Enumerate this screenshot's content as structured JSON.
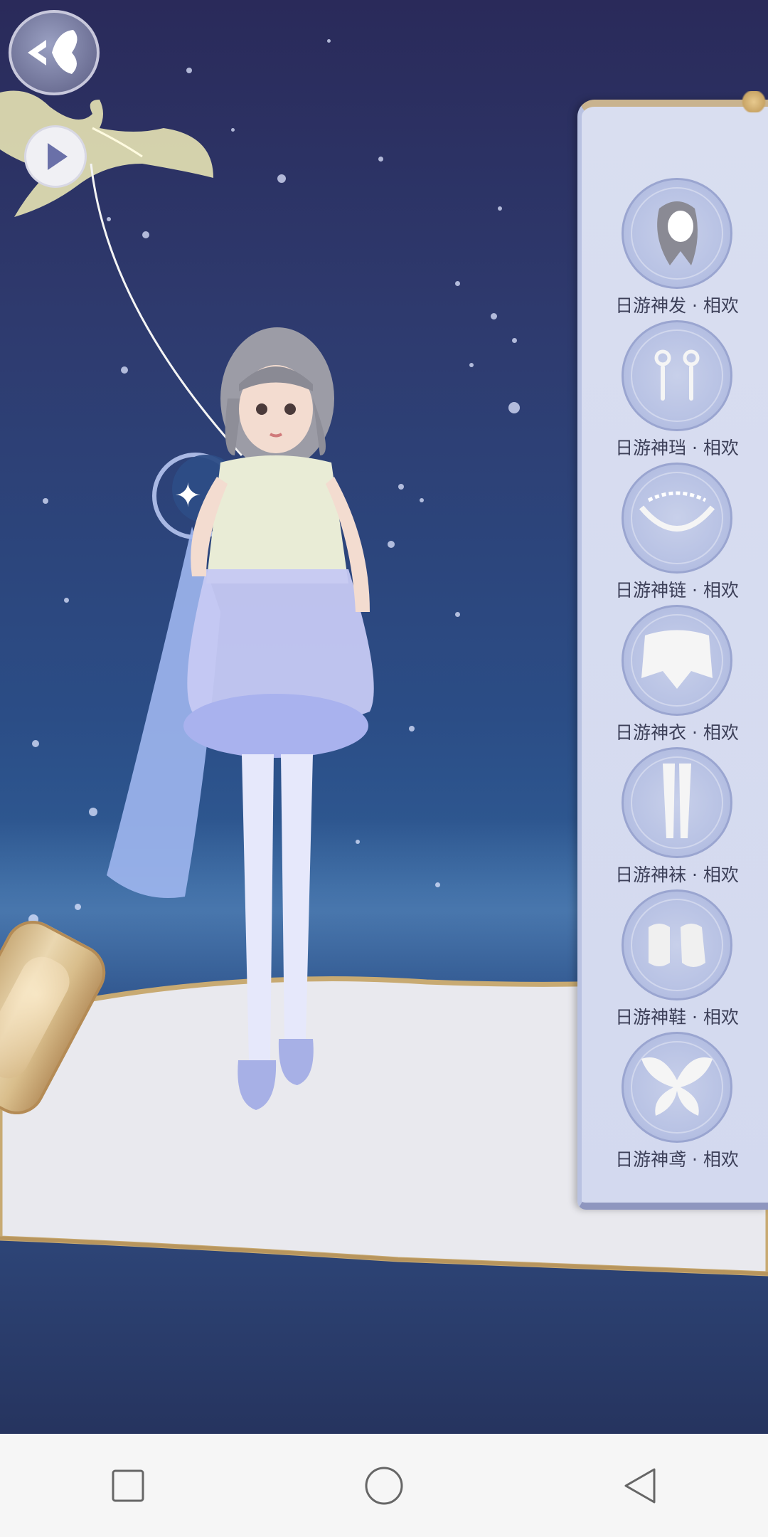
{
  "app": {
    "back_button": {
      "icon": "back-butterfly-icon"
    },
    "play_button": {
      "icon": "play-icon"
    }
  },
  "outfit_panel": {
    "items": [
      {
        "label": "日游神发 · 相欢",
        "icon": "hair-icon"
      },
      {
        "label": "日游神珰 · 相欢",
        "icon": "earrings-icon"
      },
      {
        "label": "日游神链 · 相欢",
        "icon": "necklace-icon"
      },
      {
        "label": "日游神衣 · 相欢",
        "icon": "dress-icon"
      },
      {
        "label": "日游神袜 · 相欢",
        "icon": "stockings-icon"
      },
      {
        "label": "日游神鞋 · 相欢",
        "icon": "shoes-icon"
      },
      {
        "label": "日游神鸢 · 相欢",
        "icon": "kite-icon"
      }
    ]
  },
  "navbar": {
    "buttons": [
      {
        "name": "recents",
        "icon": "square-icon"
      },
      {
        "name": "home",
        "icon": "circle-icon"
      },
      {
        "name": "back",
        "icon": "triangle-back-icon"
      }
    ]
  },
  "colors": {
    "sky_top": "#2a2a5a",
    "sky_mid": "#2b4d86",
    "panel_bg": "#d9def0",
    "label_text": "#3c3f58",
    "navbar_bg": "#f6f6f6",
    "nav_icon": "#666666"
  }
}
